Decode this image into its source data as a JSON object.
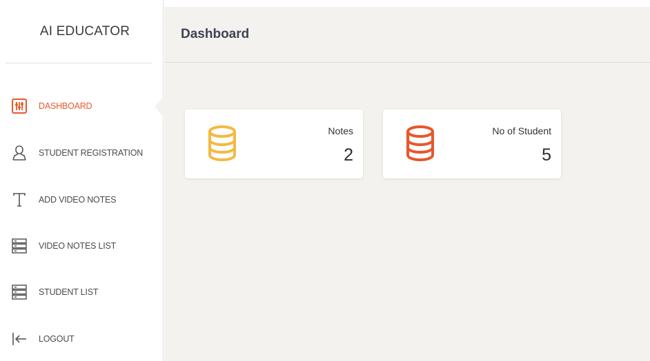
{
  "brand": {
    "title": "AI EDUCATOR"
  },
  "header": {
    "title": "Dashboard"
  },
  "colors": {
    "accent": "#e8572a",
    "notes_icon": "#f4b942",
    "students_icon": "#e8572a",
    "main_bg": "#f3f2ef"
  },
  "sidebar": {
    "items": [
      {
        "label": "DASHBOARD",
        "icon": "sliders-icon",
        "active": true
      },
      {
        "label": "STUDENT REGISTRATION",
        "icon": "user-icon",
        "active": false
      },
      {
        "label": "ADD VIDEO NOTES",
        "icon": "text-icon",
        "active": false
      },
      {
        "label": "VIDEO NOTES LIST",
        "icon": "list-icon",
        "active": false
      },
      {
        "label": "STUDENT LIST",
        "icon": "list-icon",
        "active": false
      },
      {
        "label": "LOGOUT",
        "icon": "logout-icon",
        "active": false
      }
    ]
  },
  "cards": [
    {
      "label": "Notes",
      "value": "2",
      "icon": "database-icon"
    },
    {
      "label": "No of Student",
      "value": "5",
      "icon": "database-icon"
    }
  ]
}
